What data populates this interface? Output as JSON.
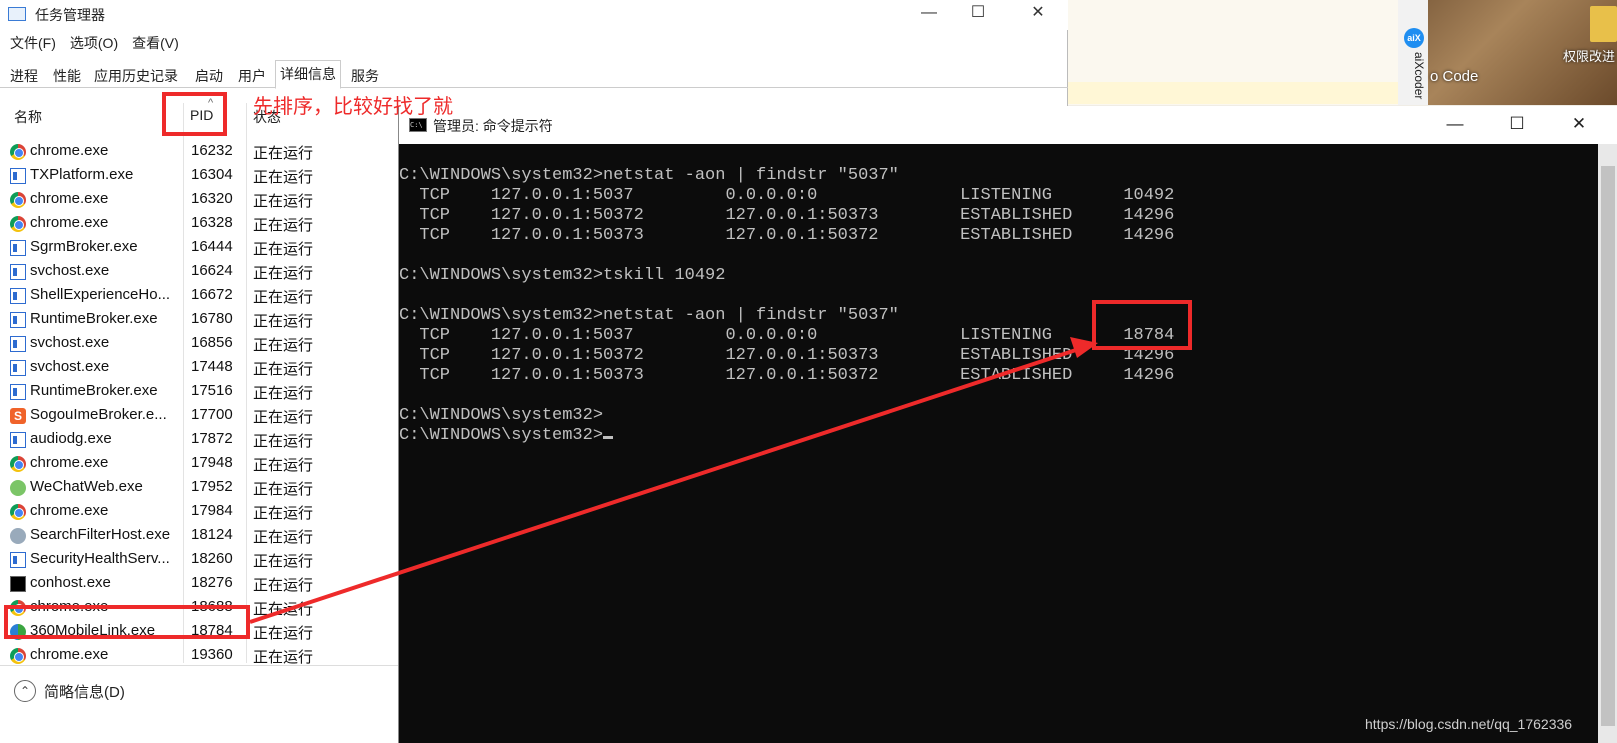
{
  "desktop": {
    "aixcoder_label": "aiXcoder",
    "vscode_label": "o Code",
    "permission_label": "权限改进"
  },
  "task_manager": {
    "title": "任务管理器",
    "window_buttons": {
      "minimize": "—",
      "maximize": "☐",
      "close": "✕"
    },
    "menu": [
      "文件(F)",
      "选项(O)",
      "查看(V)"
    ],
    "tabs": [
      "进程",
      "性能",
      "应用历史记录",
      "启动",
      "用户",
      "详细信息",
      "服务"
    ],
    "active_tab": "详细信息",
    "columns": {
      "name": "名称",
      "pid": "PID",
      "status": "状态",
      "sort_indicator": "^"
    },
    "rows": [
      {
        "icon": "chrome-icon",
        "name": "chrome.exe",
        "pid": "16232",
        "status": "正在运行"
      },
      {
        "icon": "window-app-icon",
        "name": "TXPlatform.exe",
        "pid": "16304",
        "status": "正在运行"
      },
      {
        "icon": "chrome-icon",
        "name": "chrome.exe",
        "pid": "16320",
        "status": "正在运行"
      },
      {
        "icon": "chrome-icon",
        "name": "chrome.exe",
        "pid": "16328",
        "status": "正在运行"
      },
      {
        "icon": "window-app-icon",
        "name": "SgrmBroker.exe",
        "pid": "16444",
        "status": "正在运行"
      },
      {
        "icon": "window-app-icon",
        "name": "svchost.exe",
        "pid": "16624",
        "status": "正在运行"
      },
      {
        "icon": "window-app-icon",
        "name": "ShellExperienceHo...",
        "pid": "16672",
        "status": "正在运行"
      },
      {
        "icon": "window-app-icon",
        "name": "RuntimeBroker.exe",
        "pid": "16780",
        "status": "正在运行"
      },
      {
        "icon": "window-app-icon",
        "name": "svchost.exe",
        "pid": "16856",
        "status": "正在运行"
      },
      {
        "icon": "window-app-icon",
        "name": "svchost.exe",
        "pid": "17448",
        "status": "正在运行"
      },
      {
        "icon": "window-app-icon",
        "name": "RuntimeBroker.exe",
        "pid": "17516",
        "status": "正在运行"
      },
      {
        "icon": "sogou-icon",
        "name": "SogouImeBroker.e...",
        "pid": "17700",
        "status": "正在运行"
      },
      {
        "icon": "window-app-icon",
        "name": "audiodg.exe",
        "pid": "17872",
        "status": "正在运行"
      },
      {
        "icon": "chrome-icon",
        "name": "chrome.exe",
        "pid": "17948",
        "status": "正在运行"
      },
      {
        "icon": "wechat-icon",
        "name": "WeChatWeb.exe",
        "pid": "17952",
        "status": "正在运行"
      },
      {
        "icon": "chrome-icon",
        "name": "chrome.exe",
        "pid": "17984",
        "status": "正在运行"
      },
      {
        "icon": "search-filter-icon",
        "name": "SearchFilterHost.exe",
        "pid": "18124",
        "status": "正在运行"
      },
      {
        "icon": "window-app-icon",
        "name": "SecurityHealthServ...",
        "pid": "18260",
        "status": "正在运行"
      },
      {
        "icon": "console-icon",
        "name": "conhost.exe",
        "pid": "18276",
        "status": "正在运行"
      },
      {
        "icon": "chrome-icon",
        "name": "chrome.exe",
        "pid": "18688",
        "status": "正在运行"
      },
      {
        "icon": "360-icon",
        "name": "360MobileLink.exe",
        "pid": "18784",
        "status": "正在运行"
      },
      {
        "icon": "chrome-icon",
        "name": "chrome.exe",
        "pid": "19360",
        "status": "正在运行"
      }
    ],
    "footer_label": "简略信息(D)"
  },
  "annotation": {
    "text": "先排序，比较好找了就",
    "color": "#ee2a2a"
  },
  "cmd": {
    "title": "管理员: 命令提示符",
    "window_buttons": {
      "minimize": "—",
      "maximize": "☐",
      "close": "✕"
    },
    "lines": [
      "C:\\WINDOWS\\system32>netstat -aon | findstr \"5037\"",
      "  TCP    127.0.0.1:5037         0.0.0.0:0              LISTENING       10492",
      "  TCP    127.0.0.1:50372        127.0.0.1:50373        ESTABLISHED     14296",
      "  TCP    127.0.0.1:50373        127.0.0.1:50372        ESTABLISHED     14296",
      "",
      "C:\\WINDOWS\\system32>tskill 10492",
      "",
      "C:\\WINDOWS\\system32>netstat -aon | findstr \"5037\"",
      "  TCP    127.0.0.1:5037         0.0.0.0:0              LISTENING       18784",
      "  TCP    127.0.0.1:50372        127.0.0.1:50373        ESTABLISHED     14296",
      "  TCP    127.0.0.1:50373        127.0.0.1:50372        ESTABLISHED     14296",
      "",
      "C:\\WINDOWS\\system32>",
      "C:\\WINDOWS\\system32>"
    ],
    "background": "#0c0c0c",
    "foreground": "#c0c0c0"
  },
  "watermark": "https://blog.csdn.net/qq_1762336"
}
